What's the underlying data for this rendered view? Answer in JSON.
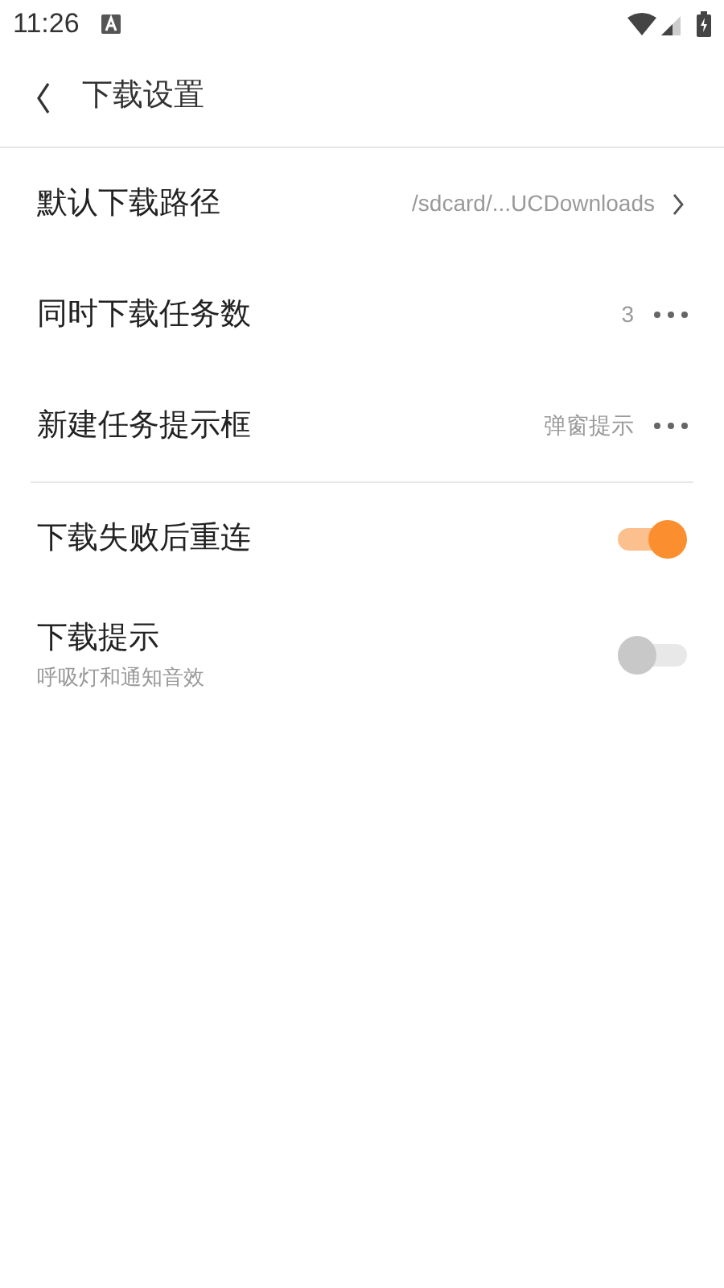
{
  "status_bar": {
    "time": "11:26"
  },
  "header": {
    "title": "下载设置"
  },
  "groups": [
    {
      "items": [
        {
          "kind": "link",
          "label": "默认下载路径",
          "value": "/sdcard/...UCDownloads"
        },
        {
          "kind": "menu",
          "label": "同时下载任务数",
          "value": "3"
        },
        {
          "kind": "menu",
          "label": "新建任务提示框",
          "value": "弹窗提示"
        }
      ]
    },
    {
      "items": [
        {
          "kind": "toggle",
          "label": "下载失败后重连",
          "on": true
        },
        {
          "kind": "toggle",
          "label": "下载提示",
          "subtitle": "呼吸灯和通知音效",
          "on": false
        }
      ]
    }
  ]
}
